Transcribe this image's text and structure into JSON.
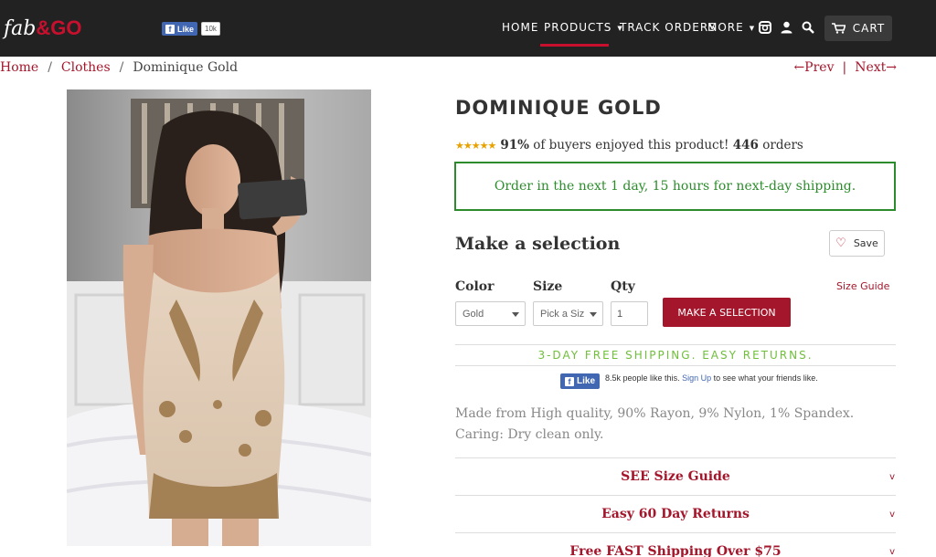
{
  "header": {
    "logo_fab": "fab",
    "logo_go": "&GO",
    "fb_like_label": "Like",
    "fb_like_count": "10k",
    "nav": {
      "home": "HOME",
      "products": "PRODUCTS",
      "track_orders": "TRACK ORDERS",
      "more": "MORE"
    },
    "icons": [
      "instagram-icon",
      "user-icon",
      "search-icon",
      "cart-icon"
    ],
    "cart_label": "CART"
  },
  "breadcrumb": {
    "home": "Home",
    "clothes": "Clothes",
    "current": "Dominique Gold",
    "separator": "/"
  },
  "pager": {
    "prev": "←Prev",
    "separator": "|",
    "next": "Next→"
  },
  "product": {
    "title": "DOMINIQUE GOLD",
    "stars": "★★★★★",
    "rating_pct": "91%",
    "rating_text": "of buyers enjoyed this product!",
    "orders_count": "446",
    "orders_label": "orders",
    "shipping_notice": "Order in the next 1 day, 15 hours for next-day shipping.",
    "make_selection_heading": "Make a selection",
    "save_label": "Save",
    "color_label": "Color",
    "color_value": "Gold",
    "size_label": "Size",
    "size_value": "Pick a Siz",
    "qty_label": "Qty",
    "qty_value": "1",
    "cta_label": "MAKE A SELECTION",
    "size_guide_link": "Size Guide",
    "free_shipping_banner": "3-DAY FREE SHIPPING. EASY RETURNS.",
    "fb_like_label": "Like",
    "fb_social_prefix": "8.5k people like this.",
    "fb_signup_link": "Sign Up",
    "fb_social_suffix": "to see what your friends like.",
    "description": "Made from High quality, 90% Rayon, 9% Nylon, 1% Spandex. Caring: Dry clean only.",
    "accordion": [
      {
        "label": "SEE Size Guide",
        "chevron": "v"
      },
      {
        "label": "Easy 60 Day Returns",
        "chevron": "v"
      },
      {
        "label": "Free FAST Shipping Over $75",
        "chevron": "v"
      }
    ]
  },
  "colors": {
    "brand_red": "#a3162b",
    "header_bg": "#222222",
    "success_green": "#2c8c2c",
    "banner_green": "#6fbf3a",
    "fb_blue": "#4267b2",
    "star_gold": "#e8a200"
  }
}
